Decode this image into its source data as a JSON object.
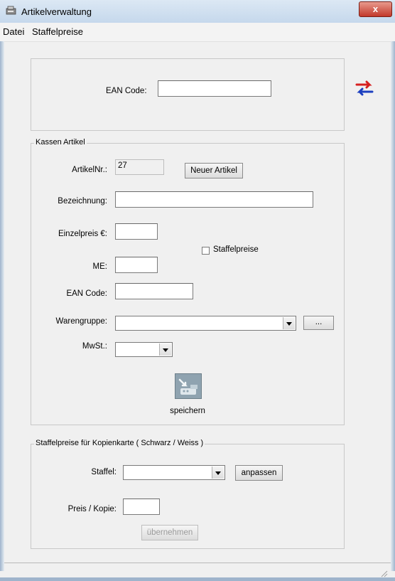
{
  "window": {
    "title": "Artikelverwaltung",
    "close_glyph": "x"
  },
  "menu": [
    "Datei",
    "Staffelpreise"
  ],
  "top": {
    "ean_label": "EAN Code:",
    "ean_value": "",
    "swap_icon": "swap-arrows-icon"
  },
  "kassen": {
    "legend": "Kassen Artikel",
    "artikelnr_label": "ArtikelNr.:",
    "artikelnr_value": "27",
    "neuer_label": "Neuer Artikel",
    "bezeichnung_label": "Bezeichnung:",
    "einzelpreis_label": "Einzelpreis €:",
    "staffelpreise_label": "Staffelpreise",
    "me_label": "ME:",
    "ean_label": "EAN Code:",
    "warengruppe_label": "Warengruppe:",
    "browse_label": "...",
    "mwst_label": "MwSt.:",
    "save_label": "speichern",
    "save_icon": "save-register-icon"
  },
  "staffel": {
    "legend": "Staffelpreise für Kopienkarte ( Schwarz / Weiss )",
    "staffel_label": "Staffel:",
    "anpassen_label": "anpassen",
    "preis_label": "Preis / Kopie:",
    "uebernehmen_label": "übernehmen"
  },
  "colors": {
    "arrow_red": "#d62020",
    "arrow_blue": "#1c3fc0",
    "close_red": "#c2382a"
  }
}
